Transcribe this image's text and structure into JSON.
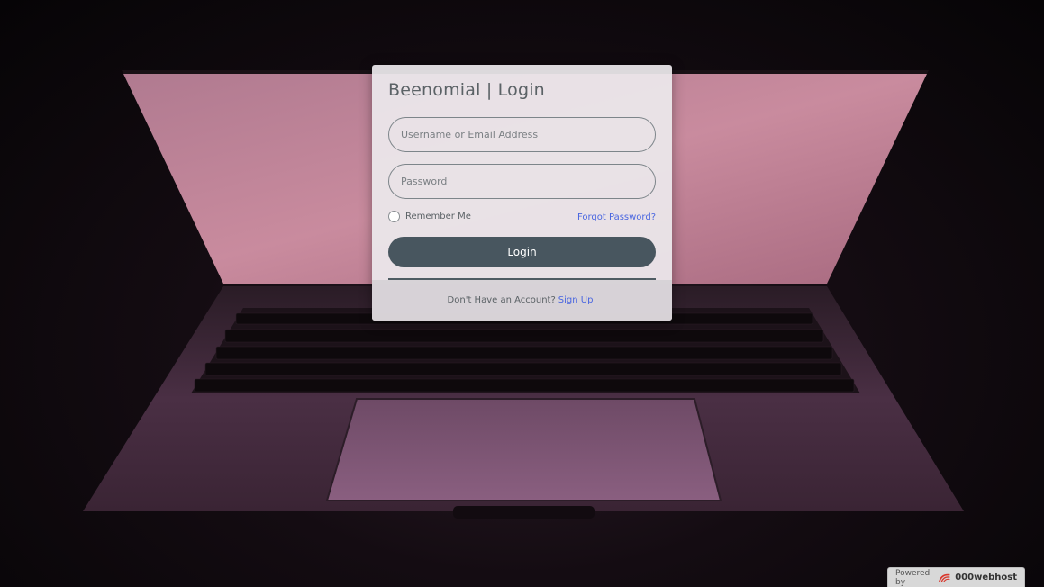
{
  "login": {
    "title": "Beenomial | Login",
    "username_placeholder": "Username or Email Address",
    "password_placeholder": "Password",
    "remember_label": "Remember Me",
    "forgot_label": "Forgot Password?",
    "submit_label": "Login",
    "signup_prompt": "Don't Have an Account?",
    "signup_link": "Sign Up!"
  },
  "badge": {
    "powered_label": "Powered by",
    "brand": "000webhost"
  },
  "colors": {
    "button": "#48565f",
    "link": "#4a66e0",
    "card": "#ece8ec"
  }
}
